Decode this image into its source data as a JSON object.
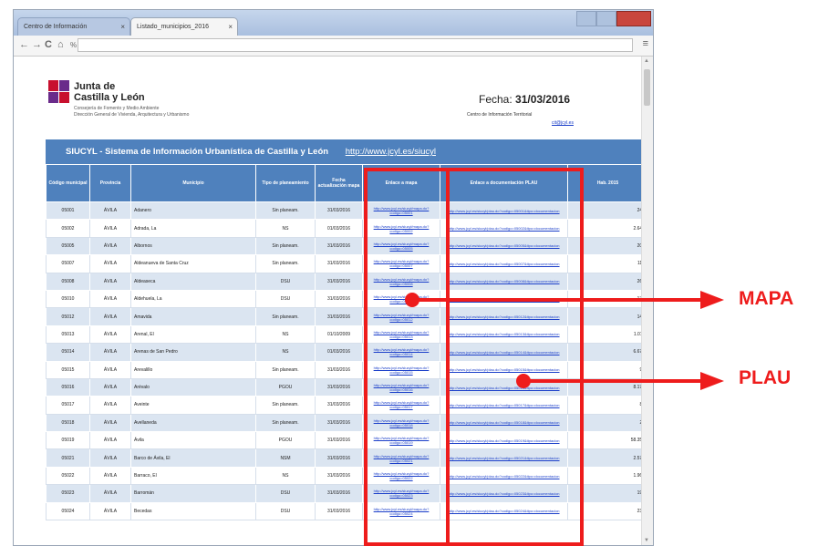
{
  "browser": {
    "tabs": [
      {
        "label": "Centro de Información"
      },
      {
        "label": "Listado_municipios_2016"
      }
    ],
    "tab_close": "×",
    "address": "",
    "nav": {
      "back": "←",
      "forward": "→",
      "reload": "C",
      "home": "⌂",
      "lock": "%"
    },
    "menu": "≡"
  },
  "header": {
    "org_line1": "Junta de",
    "org_line2": "Castilla y León",
    "dept_line1": "Consejería de Fomento y Medio Ambiente",
    "dept_line2": "Dirección General de Vivienda, Arquitectura y Urbanismo",
    "fecha_label": "Fecha:",
    "fecha_value": "31/03/2016",
    "centro": "Centro de Información Territorial",
    "cit": "cit@jcyl.es"
  },
  "table": {
    "title": "SIUCYL - Sistema de Información Urbanística de Castilla y León",
    "url": "http://www.jcyl.es/siucyl",
    "columns": [
      "Código municipal",
      "Provincia",
      "Municipio",
      "Tipo de planeamiento",
      "Fecha actualización mapa",
      "Enlace a mapa",
      "Enlace a documentación PLAU",
      "Hab. 2015"
    ],
    "rows": [
      {
        "codigo": "05001",
        "provincia": "ÁVILA",
        "municipio": "Adanero",
        "tipo": "Sin planeam.",
        "fecha": "31/03/2016",
        "mapa": "http://www.jcyl.es/siucyl/mapa.do?codigo=05001",
        "plau": "http://www.jcyl.es/siucyl/plau.do?codigo=05001&tipo=documentacion",
        "hab": "241"
      },
      {
        "codigo": "05002",
        "provincia": "ÁVILA",
        "municipio": "Adrada, La",
        "tipo": "NS",
        "fecha": "01/03/2016",
        "mapa": "http://www.jcyl.es/siucyl/mapa.do?codigo=05002",
        "plau": "http://www.jcyl.es/siucyl/plau.do?codigo=05002&tipo=documentacion",
        "hab": "2.640"
      },
      {
        "codigo": "05005",
        "provincia": "ÁVILA",
        "municipio": "Albornos",
        "tipo": "Sin planeam.",
        "fecha": "31/03/2016",
        "mapa": "http://www.jcyl.es/siucyl/mapa.do?codigo=05005",
        "plau": "http://www.jcyl.es/siucyl/plau.do?codigo=05005&tipo=documentacion",
        "hab": "200"
      },
      {
        "codigo": "05007",
        "provincia": "ÁVILA",
        "municipio": "Aldeanueva de Santa Cruz",
        "tipo": "Sin planeam.",
        "fecha": "31/03/2016",
        "mapa": "http://www.jcyl.es/siucyl/mapa.do?codigo=05007",
        "plau": "http://www.jcyl.es/siucyl/plau.do?codigo=05007&tipo=documentacion",
        "hab": "115"
      },
      {
        "codigo": "05008",
        "provincia": "ÁVILA",
        "municipio": "Aldeaseca",
        "tipo": "DSU",
        "fecha": "31/03/2016",
        "mapa": "http://www.jcyl.es/siucyl/mapa.do?codigo=05008",
        "plau": "http://www.jcyl.es/siucyl/plau.do?codigo=05008&tipo=documentacion",
        "hab": "262"
      },
      {
        "codigo": "05010",
        "provincia": "ÁVILA",
        "municipio": "Aldehuela, La",
        "tipo": "DSU",
        "fecha": "31/03/2016",
        "mapa": "http://www.jcyl.es/siucyl/mapa.do?codigo=05010",
        "plau": "http://www.jcyl.es/siucyl/plau.do?codigo=05010&tipo=documentacion",
        "hab": "173"
      },
      {
        "codigo": "05012",
        "provincia": "ÁVILA",
        "municipio": "Amavida",
        "tipo": "Sin planeam.",
        "fecha": "31/03/2016",
        "mapa": "http://www.jcyl.es/siucyl/mapa.do?codigo=05012",
        "plau": "http://www.jcyl.es/siucyl/plau.do?codigo=05012&tipo=documentacion",
        "hab": "147"
      },
      {
        "codigo": "05013",
        "provincia": "ÁVILA",
        "municipio": "Arenal, El",
        "tipo": "NS",
        "fecha": "01/10/2009",
        "mapa": "http://www.jcyl.es/siucyl/mapa.do?codigo=05013",
        "plau": "http://www.jcyl.es/siucyl/plau.do?codigo=05013&tipo=documentacion",
        "hab": "1.011"
      },
      {
        "codigo": "05014",
        "provincia": "ÁVILA",
        "municipio": "Arenas de San Pedro",
        "tipo": "NS",
        "fecha": "01/03/2016",
        "mapa": "http://www.jcyl.es/siucyl/mapa.do?codigo=05014",
        "plau": "http://www.jcyl.es/siucyl/plau.do?codigo=05014&tipo=documentacion",
        "hab": "6.671"
      },
      {
        "codigo": "05015",
        "provincia": "ÁVILA",
        "municipio": "Arevalillo",
        "tipo": "Sin planeam.",
        "fecha": "31/03/2016",
        "mapa": "http://www.jcyl.es/siucyl/mapa.do?codigo=05015",
        "plau": "http://www.jcyl.es/siucyl/plau.do?codigo=05015&tipo=documentacion",
        "hab": "98"
      },
      {
        "codigo": "05016",
        "provincia": "ÁVILA",
        "municipio": "Arévalo",
        "tipo": "PGOU",
        "fecha": "31/03/2016",
        "mapa": "http://www.jcyl.es/siucyl/mapa.do?codigo=05016",
        "plau": "http://www.jcyl.es/siucyl/plau.do?codigo=05016&tipo=documentacion",
        "hab": "8.172"
      },
      {
        "codigo": "05017",
        "provincia": "ÁVILA",
        "municipio": "Aveinte",
        "tipo": "Sin planeam.",
        "fecha": "31/03/2016",
        "mapa": "http://www.jcyl.es/siucyl/mapa.do?codigo=05017",
        "plau": "http://www.jcyl.es/siucyl/plau.do?codigo=05017&tipo=documentacion",
        "hab": "84"
      },
      {
        "codigo": "05018",
        "provincia": "ÁVILA",
        "municipio": "Avellaneda",
        "tipo": "Sin planeam.",
        "fecha": "31/03/2016",
        "mapa": "http://www.jcyl.es/siucyl/mapa.do?codigo=05018",
        "plau": "http://www.jcyl.es/siucyl/plau.do?codigo=05018&tipo=documentacion",
        "hab": "29"
      },
      {
        "codigo": "05019",
        "provincia": "ÁVILA",
        "municipio": "Ávila",
        "tipo": "PGOU",
        "fecha": "31/03/2016",
        "mapa": "http://www.jcyl.es/siucyl/mapa.do?codigo=05019",
        "plau": "http://www.jcyl.es/siucyl/plau.do?codigo=05019&tipo=documentacion",
        "hab": "58.358"
      },
      {
        "codigo": "05021",
        "provincia": "ÁVILA",
        "municipio": "Barco de Ávila, El",
        "tipo": "NSM",
        "fecha": "31/03/2016",
        "mapa": "http://www.jcyl.es/siucyl/mapa.do?codigo=05021",
        "plau": "http://www.jcyl.es/siucyl/plau.do?codigo=05021&tipo=documentacion",
        "hab": "2.576"
      },
      {
        "codigo": "05022",
        "provincia": "ÁVILA",
        "municipio": "Barraco, El",
        "tipo": "NS",
        "fecha": "31/03/2016",
        "mapa": "http://www.jcyl.es/siucyl/mapa.do?codigo=05022",
        "plau": "http://www.jcyl.es/siucyl/plau.do?codigo=05022&tipo=documentacion",
        "hab": "1.968"
      },
      {
        "codigo": "05023",
        "provincia": "ÁVILA",
        "municipio": "Barromán",
        "tipo": "DSU",
        "fecha": "31/03/2016",
        "mapa": "http://www.jcyl.es/siucyl/mapa.do?codigo=05023",
        "plau": "http://www.jcyl.es/siucyl/plau.do?codigo=05023&tipo=documentacion",
        "hab": "198"
      },
      {
        "codigo": "05024",
        "provincia": "ÁVILA",
        "municipio": "Becedas",
        "tipo": "DSU",
        "fecha": "31/03/2016",
        "mapa": "http://www.jcyl.es/siucyl/mapa.do?codigo=05024",
        "plau": "http://www.jcyl.es/siucyl/plau.do?codigo=05024&tipo=documentacion",
        "hab": "236"
      }
    ]
  },
  "annotations": {
    "mapa": "MAPA",
    "plau": "PLAU",
    "color": "#ee1c1c"
  }
}
